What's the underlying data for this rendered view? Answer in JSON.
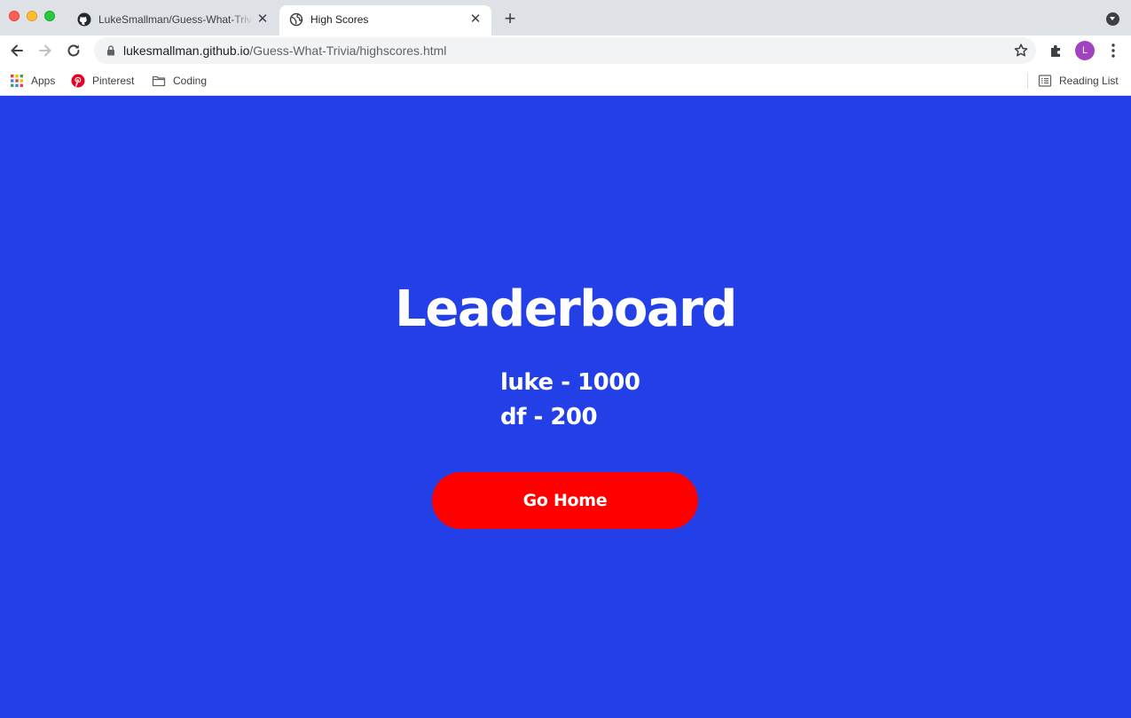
{
  "browser": {
    "tabs": [
      {
        "title": "LukeSmallman/Guess-What-Trivia",
        "favicon": "github-icon",
        "active": false
      },
      {
        "title": "High Scores",
        "favicon": "globe-icon",
        "active": true
      }
    ],
    "url": {
      "host": "lukesmallman.github.io",
      "path": "/Guess-What-Trivia/highscores.html"
    },
    "profile_initial": "L",
    "bookmarks": [
      {
        "label": "Apps",
        "icon": "apps-grid-icon"
      },
      {
        "label": "Pinterest",
        "icon": "pinterest-icon"
      },
      {
        "label": "Coding",
        "icon": "folder-icon"
      }
    ],
    "reading_list_label": "Reading List"
  },
  "page": {
    "heading": "Leaderboard",
    "scores": [
      "luke - 1000",
      "df - 200"
    ],
    "home_button_label": "Go Home"
  },
  "colors": {
    "page_background": "#2340e8",
    "button_background": "#ff0000",
    "text": "#ffffff"
  }
}
